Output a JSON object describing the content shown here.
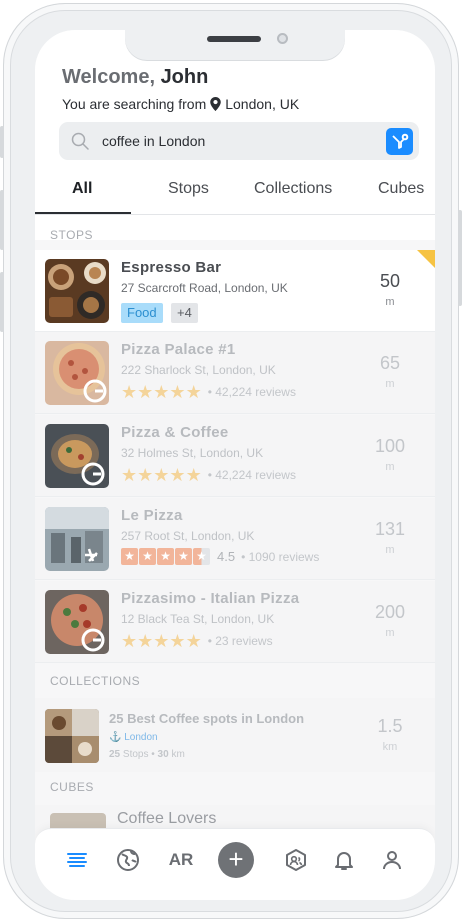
{
  "header": {
    "greeting": "Welcome,",
    "user_name": "John",
    "searching_from_prefix": "You are searching from",
    "location": "London, UK"
  },
  "search": {
    "query": "coffee in London",
    "filter_icon": "filter-icon"
  },
  "tabs": [
    "All",
    "Stops",
    "Collections",
    "Cubes"
  ],
  "active_tab": "All",
  "sections": {
    "stops": "STOPS",
    "collections": "COLLECTIONS",
    "cubes": "CUBES"
  },
  "stops": [
    {
      "name": "Espresso Bar",
      "address": "27 Scarcroft Road, London, UK",
      "tag": "Food",
      "tag_more": "+4",
      "distance": "50",
      "unit": "m"
    },
    {
      "name": "Pizza Palace #1",
      "address": "222 Sharlock St, London, UK",
      "stars": 5,
      "reviews": "• 42,224 reviews",
      "distance": "65",
      "unit": "m",
      "source": "google"
    },
    {
      "name": "Pizza & Coffee",
      "address": "32 Holmes St, London, UK",
      "stars": 5,
      "reviews": "• 42,224 reviews",
      "distance": "100",
      "unit": "m",
      "source": "google"
    },
    {
      "name": "Le Pizza",
      "address": "257 Root St, London, UK",
      "stars": 4.5,
      "rating": "4.5",
      "reviews": "• 1090 reviews",
      "distance": "131",
      "unit": "m",
      "source": "yelp"
    },
    {
      "name": "Pizzasimo - Italian Pizza",
      "address": "12 Black Tea St, London, UK",
      "stars": 5,
      "reviews": "• 23 reviews",
      "distance": "200",
      "unit": "m",
      "source": "google"
    }
  ],
  "collection": {
    "title": "25 Best Coffee spots in London",
    "location": "London",
    "stops_count": "25",
    "stops_label": "Stops •",
    "km_value": "30",
    "km_label": "km",
    "distance": "1.5",
    "unit": "km"
  },
  "cube": {
    "title": "Coffee Lovers"
  },
  "nav": {
    "ar_label": "AR",
    "plus_label": "+"
  },
  "colors": {
    "accent": "#1a8cff",
    "food_tag_bg": "#a9dcfa",
    "star": "#f4d49a",
    "yelp_star": "#f2b59a",
    "corner": "#f6c343"
  }
}
